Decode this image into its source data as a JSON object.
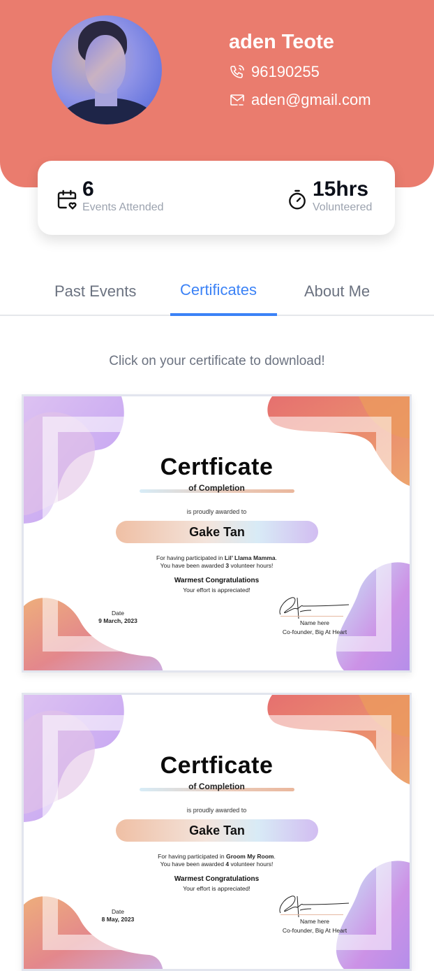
{
  "profile": {
    "name": "aden Teote",
    "phone": "96190255",
    "email": "aden@gmail.com",
    "header_color": "#ea7c6e"
  },
  "stats": {
    "events": {
      "value": "6",
      "label": "Events Attended",
      "icon": "calendar-heart-icon"
    },
    "hours": {
      "value": "15hrs",
      "label": "Volunteered",
      "icon": "stopwatch-icon"
    }
  },
  "tabs": [
    {
      "label": "Past Events",
      "active": false
    },
    {
      "label": "Certificates",
      "active": true
    },
    {
      "label": "About Me",
      "active": false
    }
  ],
  "accent_color": "#3b82f6",
  "hint": "Click on your certificate to download!",
  "certificates": [
    {
      "title": "Certficate",
      "subtitle": "of Completion",
      "awarded_to_label": "is proudly awarded to",
      "recipient": "Gake Tan",
      "participated_prefix": "For having participated in ",
      "event": "Lil’ Llama Mamma",
      "hours_prefix": "You have been awarded ",
      "hours": "3",
      "hours_suffix": " volunteer hours!",
      "congrats": "Warmest Congratulations",
      "appreciation": "Your effort is appreciated!",
      "date_label": "Date",
      "date": "9 March, 2023",
      "signer_name": "Name here",
      "signer_title": "Co-founder,  Big At Heart"
    },
    {
      "title": "Certficate",
      "subtitle": "of Completion",
      "awarded_to_label": "is proudly awarded to",
      "recipient": "Gake Tan",
      "participated_prefix": "For having participated in ",
      "event": "Groom My Room",
      "hours_prefix": "You have been awarded ",
      "hours": "4",
      "hours_suffix": " volunteer hours!",
      "congrats": "Warmest Congratulations",
      "appreciation": "Your effort is appreciated!",
      "date_label": "Date",
      "date": "8 May, 2023",
      "signer_name": "Name here",
      "signer_title": "Co-founder,  Big At Heart"
    }
  ]
}
